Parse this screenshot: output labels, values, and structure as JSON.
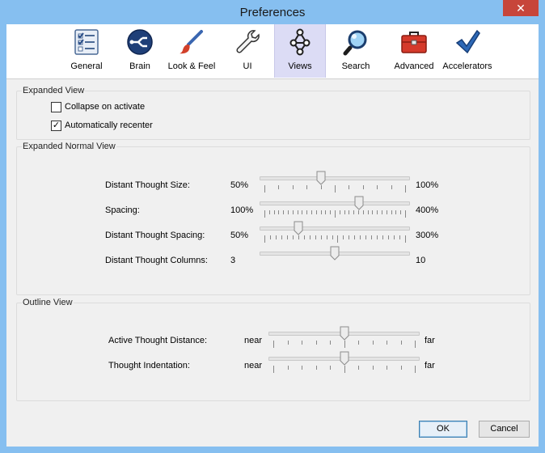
{
  "window": {
    "title": "Preferences",
    "close_glyph": "✕"
  },
  "toolbar": {
    "tabs": [
      {
        "label": "General",
        "icon": "checklist-icon"
      },
      {
        "label": "Brain",
        "icon": "brain-icon"
      },
      {
        "label": "Look & Feel",
        "icon": "brush-icon"
      },
      {
        "label": "UI",
        "icon": "wrench-icon"
      },
      {
        "label": "Views",
        "icon": "views-icon",
        "active": true
      },
      {
        "label": "Search",
        "icon": "magnifier-icon"
      },
      {
        "label": "Advanced",
        "icon": "toolbox-icon"
      },
      {
        "label": "Accelerators",
        "icon": "checkmark-icon"
      }
    ]
  },
  "expanded_view": {
    "title": "Expanded View",
    "collapse_on_activate": {
      "label": "Collapse on activate",
      "checked": false
    },
    "automatically_recenter": {
      "label": "Automatically recenter",
      "checked": true,
      "mark": "✓"
    }
  },
  "expanded_normal_view": {
    "title": "Expanded Normal View",
    "sliders": [
      {
        "label": "Distant Thought Size:",
        "min_label": "50%",
        "max_label": "100%",
        "fraction": 0.4,
        "ticks": 11
      },
      {
        "label": "Spacing:",
        "min_label": "100%",
        "max_label": "400%",
        "fraction": 0.67,
        "ticks": 31
      },
      {
        "label": "Distant Thought Spacing:",
        "min_label": "50%",
        "max_label": "300%",
        "fraction": 0.24,
        "ticks": 26
      },
      {
        "label": "Distant Thought Columns:",
        "min_label": "3",
        "max_label": "10",
        "fraction": 0.5,
        "ticks": 0
      }
    ]
  },
  "outline_view": {
    "title": "Outline View",
    "sliders": [
      {
        "label": "Active Thought Distance:",
        "min_label": "near",
        "max_label": "far",
        "fraction": 0.5,
        "ticks": 11
      },
      {
        "label": "Thought Indentation:",
        "min_label": "near",
        "max_label": "far",
        "fraction": 0.5,
        "ticks": 11
      }
    ]
  },
  "buttons": {
    "ok": "OK",
    "cancel": "Cancel"
  },
  "colors": {
    "window_frame": "#86bff0",
    "active_tab": "#dcdcf5",
    "close_button": "#c7453a"
  }
}
